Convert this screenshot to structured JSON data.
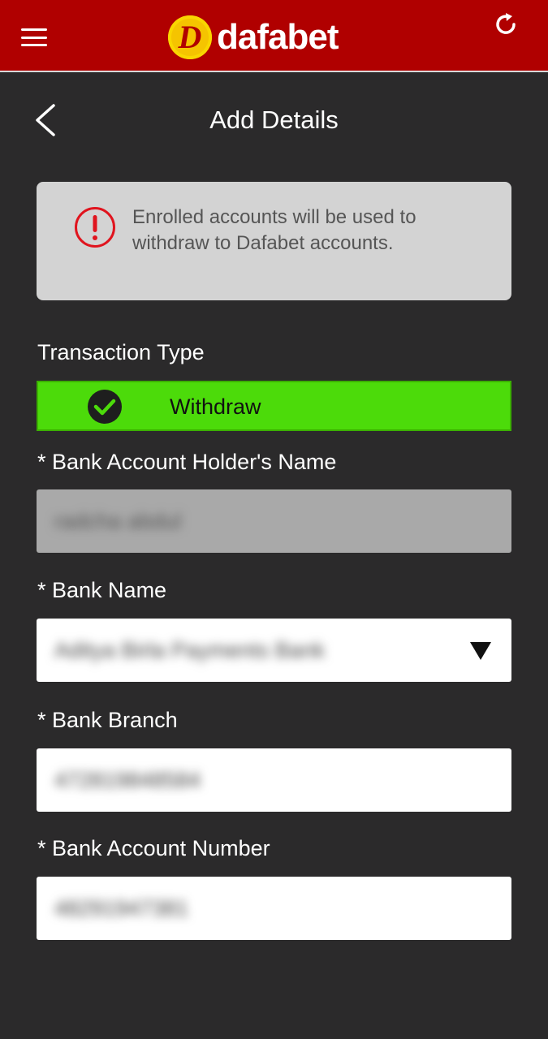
{
  "header": {
    "logo_letter": "D",
    "logo_text": "dafabet",
    "menu_icon": "hamburger-menu-icon",
    "refresh_icon": "refresh-icon"
  },
  "page": {
    "title": "Add Details",
    "back_icon": "chevron-left-icon"
  },
  "notice": {
    "icon": "exclamation-circle-icon",
    "text": "Enrolled accounts will be used to withdraw to Dafabet accounts."
  },
  "transaction": {
    "label": "Transaction Type",
    "selected": "Withdraw",
    "icon": "check-circle-icon"
  },
  "fields": {
    "holder_name": {
      "label": "* Bank Account Holder's Name",
      "value": "radcha abdul"
    },
    "bank_name": {
      "label": "* Bank Name",
      "value": "Aditya Birla Payments Bank"
    },
    "bank_branch": {
      "label": "* Bank Branch",
      "value": "472819848584"
    },
    "account_number": {
      "label": "* Bank Account Number",
      "value": "48291947381"
    }
  },
  "colors": {
    "header_bg": "#b00000",
    "page_bg": "#2b2a2b",
    "accent_green": "#4cdb0a",
    "logo_yellow": "#f5c400",
    "alert_red": "#e0141e"
  }
}
